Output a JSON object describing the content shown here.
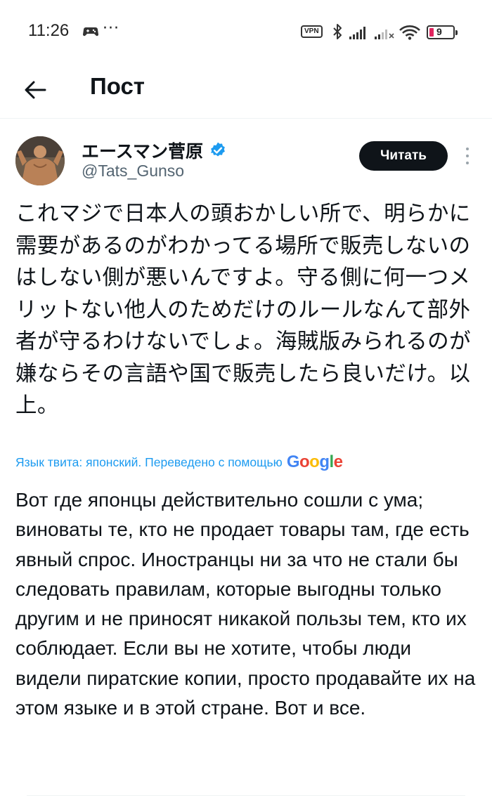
{
  "status_bar": {
    "time": "11:26",
    "dots": "···",
    "vpn": "VPN",
    "battery": "9",
    "icons": [
      "gamepad-icon",
      "bluetooth-icon",
      "signal-icon",
      "signal-weak-icon",
      "wifi-icon",
      "battery-icon"
    ]
  },
  "header": {
    "title": "Пост"
  },
  "post": {
    "author_name": "エースマン菅原",
    "author_handle": "@Tats_Gunso",
    "follow_label": "Читать",
    "original_text": "これマジで日本人の頭おかしい所で、明らかに需要があるのがわかってる場所で販売しないのはしない側が悪いんですよ。守る側に何一つメリットない他人のためだけのルールなんて部外者が守るわけないでしょ。海賊版みられるのが嫌ならその言語や国で販売したら良いだけ。以上。",
    "translation_note": "Язык твита: японский. Переведено с помощью",
    "translation_provider": "Google",
    "translated_text": "Вот где японцы действительно сошли с ума; виноваты те, кто не продает товары там, где есть явный спрос. Иностранцы ни за что не стали бы следовать правилам, которые выгодны только другим и не приносят никакой пользы тем, кто их соблюдает. Если вы не хотите, чтобы люди видели пиратские копии, просто продавайте их на этом языке и в этой стране. Вот и все."
  },
  "colors": {
    "link": "#1d9bf0",
    "text": "#0f1419",
    "secondary": "#536471",
    "button_bg": "#0f1419",
    "verified": "#1d9bf0",
    "battery_low": "#e0245e"
  }
}
